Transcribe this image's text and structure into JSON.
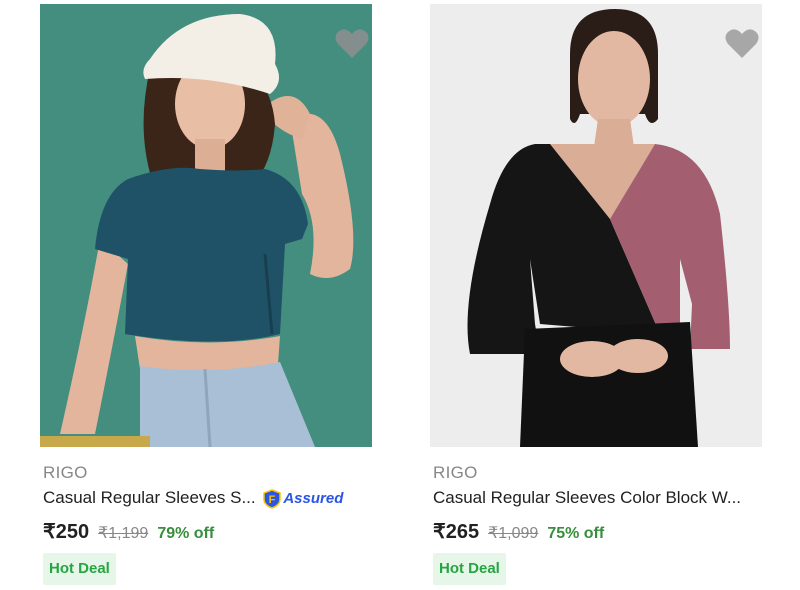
{
  "products": [
    {
      "brand": "RIGO",
      "title": "Casual Regular Sleeves S...",
      "price": "₹250",
      "mrp": "₹1,199",
      "discount": "79% off",
      "badge": "Hot Deal",
      "assured_label": "Assured",
      "image_bg": "#3f8b7b",
      "image_alt": "Woman in teal ruched crop top and white bucket hat"
    },
    {
      "brand": "RIGO",
      "title": "Casual Regular Sleeves Color Block W...",
      "price": "₹265",
      "mrp": "₹1,099",
      "discount": "75% off",
      "badge": "Hot Deal",
      "image_bg": "#ededed",
      "image_alt": "Woman in black and mauve color block V-neck top"
    }
  ],
  "icons": {
    "wishlist": "heart-icon",
    "assured": "assured-badge-icon"
  },
  "colors": {
    "discount": "#388e3c",
    "badge_bg": "#e6f7ea",
    "badge_text": "#26a541",
    "assured": "#2a55e5"
  }
}
